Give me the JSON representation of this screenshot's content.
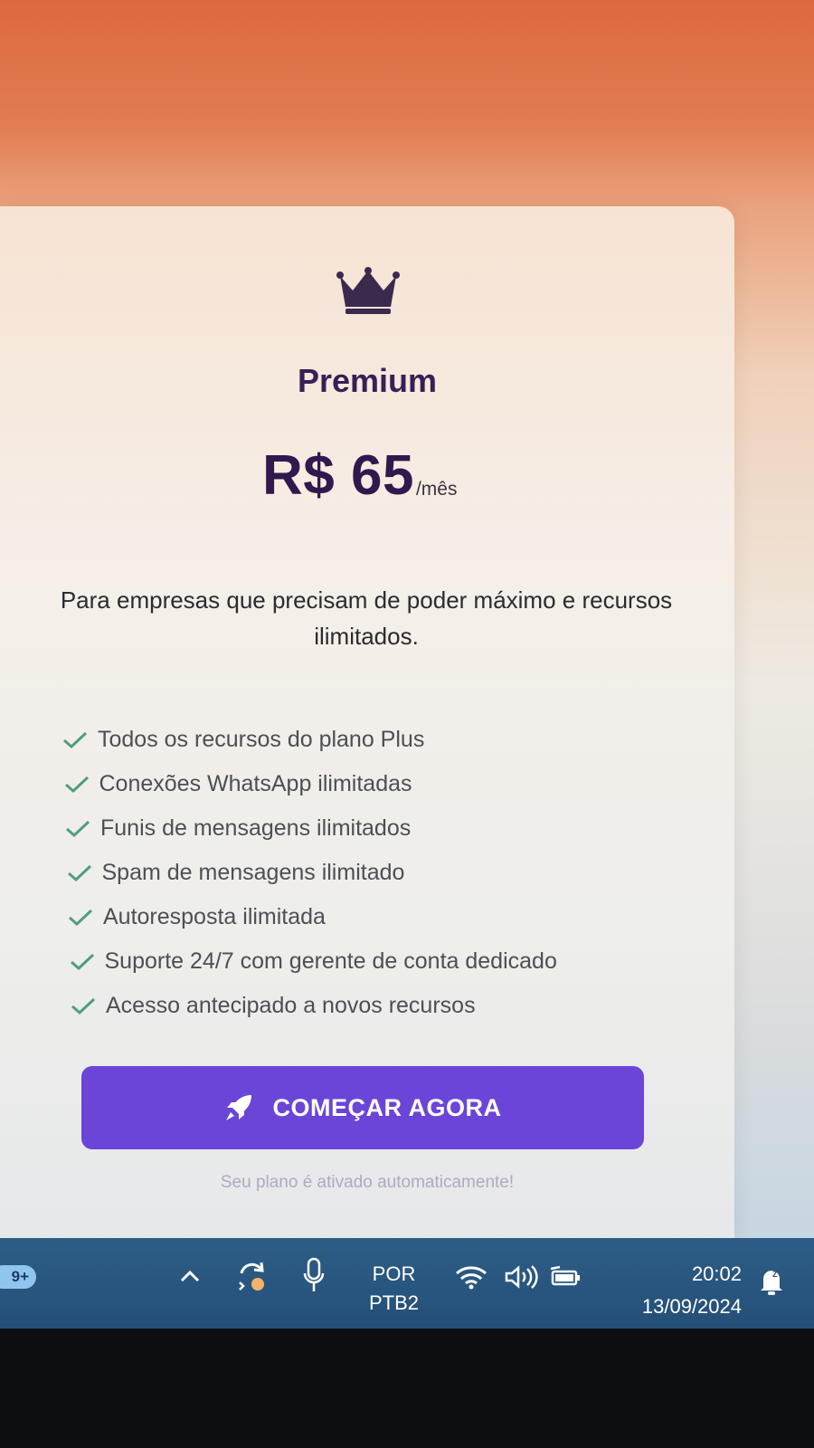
{
  "card": {
    "icon": "crown-icon",
    "plan_name": "Premium",
    "price": "R$ 65",
    "period": "/mês",
    "description": "Para empresas que precisam de poder máximo e recursos ilimitados.",
    "features": [
      "Todos os recursos do plano Plus",
      "Conexões WhatsApp ilimitadas",
      "Funis de mensagens ilimitados",
      "Spam de mensagens ilimitado",
      "Autoresposta ilimitada",
      "Suporte 24/7 com gerente de conta dedicado",
      "Acesso antecipado a novos recursos"
    ],
    "cta_label": "COMEÇAR AGORA",
    "footnote": "Seu plano é ativado automaticamente!"
  },
  "taskbar": {
    "notification_badge": "9+",
    "language_top": "POR",
    "language_bottom": "PTB2",
    "time": "20:02",
    "date": "13/09/2024"
  },
  "colors": {
    "accent": "#6a45d8",
    "heading": "#3a1e56",
    "check": "#4f9e7c",
    "taskbar": "#2a5880"
  }
}
